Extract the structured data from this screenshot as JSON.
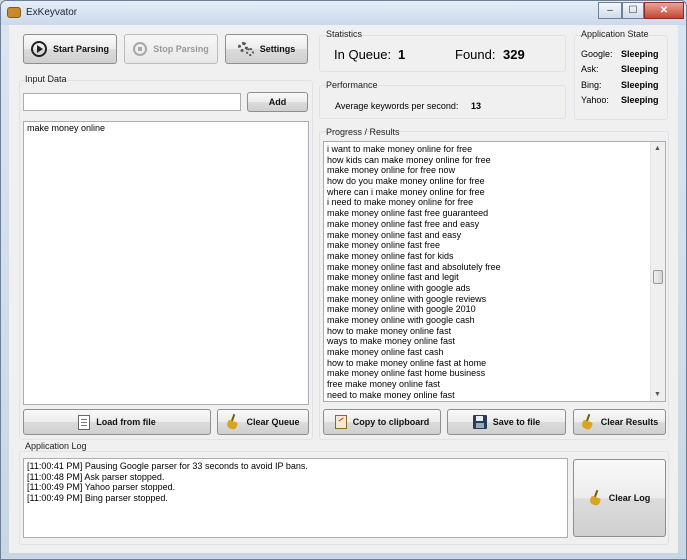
{
  "window": {
    "title": "ExKeyvator",
    "minimize": "‒",
    "maximize": "☐",
    "close": "✕"
  },
  "toolbar": {
    "start_label": "Start Parsing",
    "stop_label": "Stop Parsing",
    "settings_label": "Settings"
  },
  "input_data": {
    "title": "Input Data",
    "field_value": "",
    "add_label": "Add",
    "queue_text": "make money online",
    "load_label": "Load from file",
    "clear_queue_label": "Clear Queue"
  },
  "statistics": {
    "title": "Statistics",
    "in_queue_label": "In Queue:",
    "in_queue_value": "1",
    "found_label": "Found:",
    "found_value": "329"
  },
  "performance": {
    "title": "Performance",
    "avg_label": "Average keywords per second:",
    "avg_value": "13"
  },
  "app_state": {
    "title": "Application State",
    "engines": [
      {
        "name": "Google:",
        "state": "Sleeping"
      },
      {
        "name": "Ask:",
        "state": "Sleeping"
      },
      {
        "name": "Bing:",
        "state": "Sleeping"
      },
      {
        "name": "Yahoo:",
        "state": "Sleeping"
      }
    ]
  },
  "progress": {
    "title": "Progress / Results",
    "results": [
      "i want to make money online for free",
      "how kids can make money online for free",
      "make money online for free now",
      "how do you make money online for free",
      "where can i make money online for free",
      "i need to make money online for free",
      "make money online fast free guaranteed",
      "make money online fast free and easy",
      "make money online fast and easy",
      "make money online fast free",
      "make money online fast for kids",
      "make money online fast and absolutely free",
      "make money online fast and legit",
      "make money online with google ads",
      "make money online with google reviews",
      "make money online with google 2010",
      "make money online with google cash",
      "how to make money online fast",
      "ways to make money online fast",
      "make money online fast cash",
      "how to make money online fast at home",
      "make money online fast home business",
      "free make money online fast",
      "need to make money online fast"
    ],
    "copy_label": "Copy to clipboard",
    "save_label": "Save to file",
    "clear_results_label": "Clear Results"
  },
  "log": {
    "title": "Application Log",
    "lines": [
      "[11:00:41 PM] Pausing Google parser for 33 seconds to avoid IP bans.",
      "[11:00:48 PM] Ask parser stopped.",
      "[11:00:49 PM] Yahoo parser stopped.",
      "[11:00:49 PM] Bing parser stopped."
    ],
    "clear_label": "Clear Log"
  },
  "colors": {
    "accent": "#1f1f1f",
    "broom": "#d9a520",
    "disk": "#2a3b55"
  }
}
